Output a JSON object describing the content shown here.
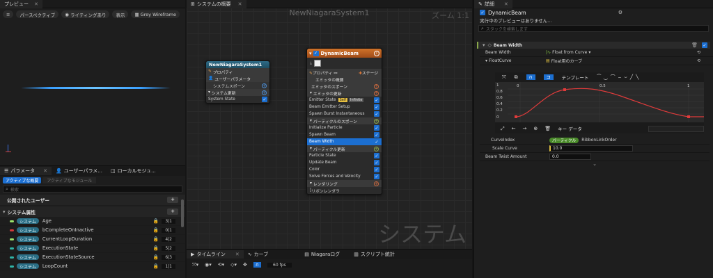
{
  "preview": {
    "tab": "プレビュー",
    "toolbar": [
      "パースペクティブ",
      "ライティングあり",
      "表示",
      "Grey Wireframe"
    ]
  },
  "system_overview": {
    "tab": "システムの概要",
    "title": "NewNiagaraSystem1",
    "zoom": "ズーム 1:1",
    "watermark": "システム",
    "system_node": {
      "title": "NewNiagaraSystem1",
      "rows": [
        "プロパティ",
        "ユーザーパラメータ",
        "システムスポーン",
        "システム更新",
        "System State"
      ]
    },
    "emitter_node": {
      "title": "DynamicBeam",
      "header": [
        "プロパティ",
        "ステージ"
      ],
      "rows": [
        {
          "label": "エミッタの概要",
          "type": "sect"
        },
        {
          "label": "エミッタのスポーン",
          "type": "sect"
        },
        {
          "label": "エミッタの更新",
          "type": "sect"
        },
        {
          "label": "Emitter State",
          "badge": "Self",
          "badge2": "Infinite",
          "type": "item"
        },
        {
          "label": "Beam Emitter Setup",
          "type": "item"
        },
        {
          "label": "Spawn Burst Instantaneous",
          "type": "item"
        },
        {
          "label": "パーティクルのスポーン",
          "type": "sect"
        },
        {
          "label": "Initialize Particle",
          "type": "item"
        },
        {
          "label": "Spawn Beam",
          "type": "item"
        },
        {
          "label": "Beam Width",
          "type": "selected"
        },
        {
          "label": "パーティクル更新",
          "type": "sect"
        },
        {
          "label": "Particle State",
          "type": "item"
        },
        {
          "label": "Update Beam",
          "type": "item"
        },
        {
          "label": "Color",
          "type": "item"
        },
        {
          "label": "Solve Forces and Velocity",
          "type": "item"
        },
        {
          "label": "レンダリング",
          "type": "sect"
        },
        {
          "label": "リボンレンダラ",
          "type": "item"
        }
      ]
    }
  },
  "params": {
    "tabs": [
      "パラメータ",
      "ユーザーパラメ...",
      "ローカルモジュ..."
    ],
    "filter_tabs": [
      "アクティブな概要",
      "アクティブなモジュール"
    ],
    "search_placeholder": "検索",
    "sections": [
      "公開されたユーザー",
      "システム属性"
    ],
    "tag": "システム",
    "rows": [
      {
        "name": "Age",
        "color": "#9be36b",
        "count": "3|1"
      },
      {
        "name": "bCompleteOnInactive",
        "color": "#d23b3b",
        "count": "0|1"
      },
      {
        "name": "CurrentLoopDuration",
        "color": "#9be36b",
        "count": "4|2"
      },
      {
        "name": "ExecutionState",
        "color": "#2fb3a6",
        "count": "5|2"
      },
      {
        "name": "ExecutionStateSource",
        "color": "#2fb3a6",
        "count": "6|3"
      },
      {
        "name": "LoopCount",
        "color": "#2fb3a6",
        "count": "1|1"
      }
    ]
  },
  "bottom": {
    "tabs": [
      "タイムライン",
      "カーブ",
      "Niagaraログ",
      "スクリプト統計"
    ],
    "fps": "60 fps"
  },
  "details": {
    "tab": "詳細",
    "title": "DynamicBeam",
    "subtitle": "実行中のプレビューはありません...",
    "search_placeholder": "スタックを検索します",
    "section": "Beam Width",
    "beam_width_label": "Beam Width",
    "beam_width_value": "Float from Curve",
    "float_curve_label": "FloatCurve",
    "float_curve_value": "Float用のカーブ",
    "template_label": "テンプレート",
    "curve_y_ticks": [
      "1",
      "0.8",
      "0.6",
      "0.4",
      "0.2",
      "0"
    ],
    "curve_x_ticks": [
      "0",
      "0.5",
      "1"
    ],
    "key_data_label": "キー データ",
    "curve_index_label": "CurveIndex",
    "curve_index_tag": "パーティクル",
    "curve_index_value": "RibbonLinkOrder",
    "scale_curve_label": "Scale Curve",
    "scale_curve_value": "10.0",
    "twist_label": "Beam Twist Amount",
    "twist_value": "0.0"
  }
}
